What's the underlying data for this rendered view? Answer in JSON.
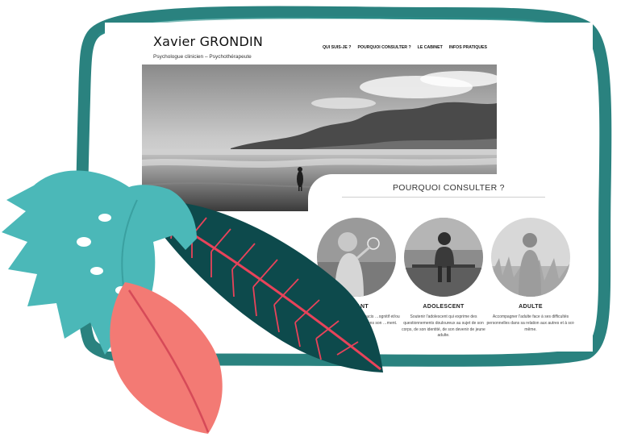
{
  "site": {
    "title": "Xavier GRONDIN",
    "tagline": "Psychologue clinicien – Psychothérapeute",
    "nav": [
      {
        "label": "QUI SUIS-JE ?"
      },
      {
        "label": "POURQUOI CONSULTER ?"
      },
      {
        "label": "LE CABINET"
      },
      {
        "label": "INFOS PRATIQUES"
      }
    ]
  },
  "section": {
    "title": "POURQUOI CONSULTER ?",
    "columns": [
      {
        "label": "ENFANT",
        "description": "…enfant qui manifeste des soucis …ognitif et/ou relationnel pour …re mieux dans son …ment."
      },
      {
        "label": "ADOLESCENT",
        "description": "Soutenir l'adolescent qui exprime des questionnements douloureux au sujet de son corps, de son identité, de son devenir de jeune adulte."
      },
      {
        "label": "ADULTE",
        "description": "Accompagner l'adulte face à ses difficultés personnelles dans sa relation aux autres et à soi-même."
      }
    ]
  },
  "colors": {
    "frame": "#1f7b78",
    "monstera": "#4bb8b8",
    "dark_leaf": "#0d4a4c",
    "leaf_veins": "#e8435a",
    "pink_leaf": "#f37a74"
  },
  "icons": [
    "monstera-leaf",
    "dark-tropical-leaf",
    "pink-leaf"
  ]
}
